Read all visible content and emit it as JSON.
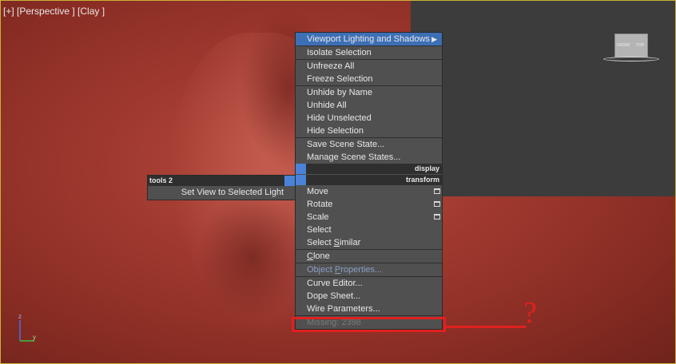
{
  "viewport": {
    "label": "[+] [Perspective ] [Clay ]",
    "viewcube_faces": [
      "FRONT",
      "TOP"
    ],
    "axis_labels": {
      "z": "z",
      "y": "y"
    }
  },
  "quad_menu": {
    "top_items": [
      {
        "label": "Viewport Lighting and Shadows",
        "has_submenu": true
      },
      {
        "label": "Isolate Selection"
      },
      {
        "label": "Unfreeze All"
      },
      {
        "label": "Freeze Selection"
      },
      {
        "label": "Unhide by Name"
      },
      {
        "label": "Unhide All"
      },
      {
        "label": "Hide Unselected"
      },
      {
        "label": "Hide Selection"
      },
      {
        "label": "Save Scene State..."
      },
      {
        "label": "Manage Scene States..."
      }
    ],
    "display_header": "display",
    "transform_header": "transform",
    "bottom_items": [
      {
        "label": "Move"
      },
      {
        "label": "Rotate"
      },
      {
        "label": "Scale"
      },
      {
        "label": "Select"
      },
      {
        "label_pre": "Select ",
        "label_u": "S",
        "label_post": "imilar"
      },
      {
        "label_u": "C",
        "label_post": "lone"
      },
      {
        "label_pre": "Object ",
        "label_u": "P",
        "label_post": "roperties..."
      },
      {
        "label": "Curve Editor..."
      },
      {
        "label": "Dope Sheet..."
      },
      {
        "label": "Wire Parameters..."
      },
      {
        "label": "Missing: 2398"
      }
    ]
  },
  "tools_menu": {
    "title": "tools 2",
    "item": "Set View to Selected Light"
  },
  "annotation": {
    "question_mark": "?",
    "color": "#e02020"
  }
}
